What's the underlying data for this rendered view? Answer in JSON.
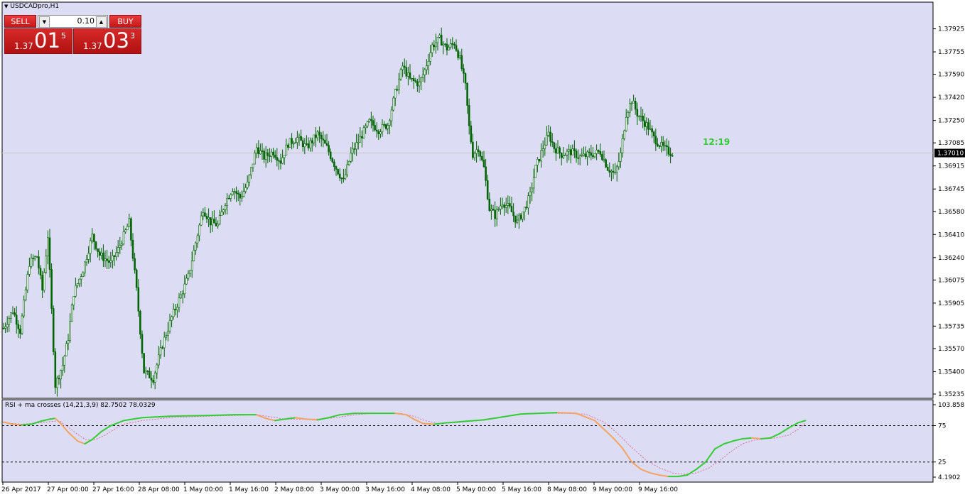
{
  "window": {
    "title": "USDCADpro,H1"
  },
  "trade_panel": {
    "sell_label": "SELL",
    "buy_label": "BUY",
    "lot": "0.10",
    "sell_price": {
      "prefix": "1.37",
      "big": "01",
      "sup": "5"
    },
    "buy_price": {
      "prefix": "1.37",
      "big": "03",
      "sup": "3"
    }
  },
  "timer": "12:19",
  "indicator_label": "RSI + ma crosses (14,21,3,9) 82.7502 78.0329",
  "colors": {
    "background": "#dcdcf5",
    "candle": "#006400",
    "rsi_up": "#32cd32",
    "rsi_down": "#f4a460",
    "signal": "#e75480",
    "timer": "#32cd32",
    "current_price_bg": "#000000"
  },
  "chart_data": [
    {
      "type": "candlestick",
      "symbol": "USDCADpro",
      "timeframe": "H1",
      "ylim": [
        1.35235,
        1.3809
      ],
      "y_ticks": [
        "1.37925",
        "1.37755",
        "1.37590",
        "1.37420",
        "1.37250",
        "1.37085",
        "1.36915",
        "1.36745",
        "1.36580",
        "1.36410",
        "1.36240",
        "1.36075",
        "1.35905",
        "1.35735",
        "1.35570",
        "1.35400",
        "1.35235"
      ],
      "current_price": "1.37010",
      "x_tick_labels": [
        "26 Apr 2017",
        "27 Apr 00:00",
        "27 Apr 16:00",
        "28 Apr 08:00",
        "1 May 00:00",
        "1 May 16:00",
        "2 May 08:00",
        "3 May 00:00",
        "3 May 16:00",
        "4 May 08:00",
        "5 May 00:00",
        "5 May 16:00",
        "8 May 08:00",
        "9 May 00:00",
        "9 May 16:00"
      ],
      "close_path": [
        [
          0,
          1.3572
        ],
        [
          5,
          1.3585
        ],
        [
          9,
          1.357
        ],
        [
          14,
          1.362
        ],
        [
          18,
          1.3625
        ],
        [
          21,
          1.36
        ],
        [
          24,
          1.364
        ],
        [
          28,
          1.353
        ],
        [
          32,
          1.3545
        ],
        [
          35,
          1.3565
        ],
        [
          38,
          1.3598
        ],
        [
          43,
          1.3615
        ],
        [
          48,
          1.364
        ],
        [
          52,
          1.3626
        ],
        [
          58,
          1.362
        ],
        [
          62,
          1.363
        ],
        [
          68,
          1.365
        ],
        [
          72,
          1.36
        ],
        [
          76,
          1.354
        ],
        [
          81,
          1.3535
        ],
        [
          86,
          1.356
        ],
        [
          91,
          1.358
        ],
        [
          96,
          1.3596
        ],
        [
          100,
          1.361
        ],
        [
          104,
          1.3635
        ],
        [
          108,
          1.366
        ],
        [
          112,
          1.365
        ],
        [
          116,
          1.3648
        ],
        [
          120,
          1.3665
        ],
        [
          124,
          1.3675
        ],
        [
          128,
          1.3668
        ],
        [
          132,
          1.3678
        ],
        [
          137,
          1.3705
        ],
        [
          141,
          1.3698
        ],
        [
          146,
          1.3702
        ],
        [
          150,
          1.3695
        ],
        [
          154,
          1.3708
        ],
        [
          159,
          1.3712
        ],
        [
          164,
          1.3705
        ],
        [
          170,
          1.3715
        ],
        [
          175,
          1.3705
        ],
        [
          180,
          1.369
        ],
        [
          184,
          1.368
        ],
        [
          188,
          1.37
        ],
        [
          193,
          1.3712
        ],
        [
          198,
          1.3724
        ],
        [
          203,
          1.3718
        ],
        [
          208,
          1.3722
        ],
        [
          212,
          1.3745
        ],
        [
          216,
          1.3765
        ],
        [
          220,
          1.3755
        ],
        [
          225,
          1.3752
        ],
        [
          228,
          1.3762
        ],
        [
          232,
          1.378
        ],
        [
          236,
          1.3785
        ],
        [
          240,
          1.3778
        ],
        [
          244,
          1.3782
        ],
        [
          247,
          1.377
        ],
        [
          250,
          1.375
        ],
        [
          252,
          1.372
        ],
        [
          254,
          1.37
        ],
        [
          257,
          1.3705
        ],
        [
          260,
          1.369
        ],
        [
          263,
          1.366
        ],
        [
          266,
          1.3655
        ],
        [
          270,
          1.3665
        ],
        [
          274,
          1.366
        ],
        [
          278,
          1.365
        ],
        [
          282,
          1.366
        ],
        [
          285,
          1.367
        ],
        [
          288,
          1.369
        ],
        [
          292,
          1.3705
        ],
        [
          295,
          1.3715
        ],
        [
          298,
          1.3705
        ],
        [
          302,
          1.37
        ],
        [
          307,
          1.3702
        ],
        [
          312,
          1.3698
        ],
        [
          318,
          1.37
        ],
        [
          323,
          1.3702
        ],
        [
          327,
          1.369
        ],
        [
          331,
          1.3685
        ],
        [
          334,
          1.37
        ],
        [
          337,
          1.373
        ],
        [
          340,
          1.374
        ],
        [
          343,
          1.373
        ],
        [
          346,
          1.3725
        ],
        [
          349,
          1.372
        ],
        [
          352,
          1.3712
        ],
        [
          356,
          1.3706
        ],
        [
          360,
          1.3702
        ],
        [
          362,
          1.3701
        ]
      ]
    },
    {
      "type": "line",
      "name": "RSI + ma crosses",
      "params": "14,21,3,9",
      "values_shown": [
        82.7502,
        78.0329
      ],
      "ylim": [
        4.1902,
        103.8585
      ],
      "y_ticks": [
        "103.8585",
        "75",
        "25",
        "4.1902"
      ],
      "levels": [
        75,
        25
      ],
      "rsi_path": [
        [
          0,
          80
        ],
        [
          5,
          77
        ],
        [
          10,
          76
        ],
        [
          15,
          77
        ],
        [
          20,
          81
        ],
        [
          25,
          84
        ],
        [
          28,
          85
        ],
        [
          31,
          78
        ],
        [
          35,
          66
        ],
        [
          40,
          54
        ],
        [
          44,
          50
        ],
        [
          48,
          56
        ],
        [
          53,
          67
        ],
        [
          58,
          75
        ],
        [
          65,
          82
        ],
        [
          75,
          86
        ],
        [
          90,
          88
        ],
        [
          110,
          89
        ],
        [
          125,
          90
        ],
        [
          137,
          90
        ],
        [
          142,
          85
        ],
        [
          147,
          82
        ],
        [
          152,
          84
        ],
        [
          158,
          86
        ],
        [
          164,
          84
        ],
        [
          170,
          83
        ],
        [
          176,
          86
        ],
        [
          182,
          90
        ],
        [
          190,
          92
        ],
        [
          200,
          92
        ],
        [
          212,
          92
        ],
        [
          218,
          90
        ],
        [
          222,
          84
        ],
        [
          227,
          78
        ],
        [
          233,
          77
        ],
        [
          240,
          79
        ],
        [
          250,
          81
        ],
        [
          260,
          83
        ],
        [
          270,
          87
        ],
        [
          280,
          91
        ],
        [
          290,
          92
        ],
        [
          300,
          93
        ],
        [
          310,
          92
        ],
        [
          320,
          82
        ],
        [
          325,
          70
        ],
        [
          330,
          58
        ],
        [
          335,
          44
        ],
        [
          340,
          25
        ],
        [
          345,
          15
        ],
        [
          350,
          10
        ],
        [
          355,
          7
        ],
        [
          360,
          5
        ],
        [
          365,
          5
        ],
        [
          370,
          7
        ],
        [
          375,
          15
        ],
        [
          380,
          25
        ],
        [
          385,
          43
        ],
        [
          390,
          50
        ],
        [
          395,
          54
        ],
        [
          400,
          57
        ],
        [
          405,
          58
        ],
        [
          410,
          57
        ],
        [
          415,
          58
        ],
        [
          420,
          64
        ],
        [
          425,
          72
        ],
        [
          430,
          79
        ],
        [
          434,
          82
        ]
      ],
      "signal_path": [
        [
          0,
          79
        ],
        [
          10,
          77
        ],
        [
          20,
          79
        ],
        [
          30,
          82
        ],
        [
          35,
          73
        ],
        [
          40,
          63
        ],
        [
          45,
          55
        ],
        [
          50,
          56
        ],
        [
          55,
          62
        ],
        [
          60,
          70
        ],
        [
          65,
          77
        ],
        [
          75,
          82
        ],
        [
          90,
          86
        ],
        [
          110,
          88
        ],
        [
          125,
          89
        ],
        [
          137,
          90
        ],
        [
          145,
          87
        ],
        [
          152,
          84
        ],
        [
          160,
          84
        ],
        [
          170,
          84
        ],
        [
          180,
          86
        ],
        [
          190,
          90
        ],
        [
          200,
          92
        ],
        [
          215,
          92
        ],
        [
          222,
          88
        ],
        [
          228,
          82
        ],
        [
          235,
          78
        ],
        [
          245,
          79
        ],
        [
          255,
          82
        ],
        [
          265,
          85
        ],
        [
          275,
          89
        ],
        [
          285,
          92
        ],
        [
          300,
          92
        ],
        [
          315,
          91
        ],
        [
          325,
          80
        ],
        [
          332,
          65
        ],
        [
          340,
          45
        ],
        [
          348,
          27
        ],
        [
          355,
          17
        ],
        [
          362,
          10
        ],
        [
          368,
          8
        ],
        [
          375,
          10
        ],
        [
          382,
          17
        ],
        [
          388,
          28
        ],
        [
          394,
          40
        ],
        [
          400,
          50
        ],
        [
          406,
          55
        ],
        [
          412,
          57
        ],
        [
          418,
          58
        ],
        [
          425,
          62
        ],
        [
          430,
          70
        ],
        [
          434,
          78
        ]
      ]
    }
  ]
}
